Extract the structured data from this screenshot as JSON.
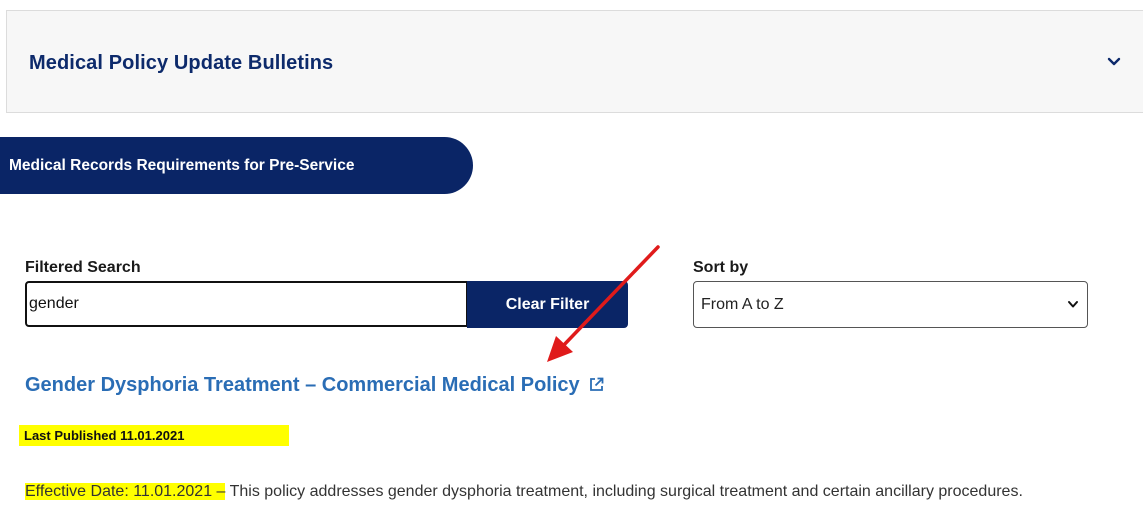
{
  "accordion": {
    "title": "Medical Policy Update Bulletins",
    "icon": "chevron-down-icon"
  },
  "pill_button": {
    "label": "Medical Records Requirements for Pre-Service"
  },
  "filter": {
    "label": "Filtered Search",
    "value": "gender",
    "clear_label": "Clear Filter"
  },
  "sort": {
    "label": "Sort by",
    "selected": "From A to Z"
  },
  "result": {
    "title": "Gender Dysphoria Treatment – Commercial Medical Policy",
    "external_icon": "external-link-icon",
    "last_published": "Last Published 11.01.2021",
    "effective_date": "Effective Date: 11.01.2021 –",
    "description": " This policy addresses gender dysphoria treatment, including surgical treatment and certain ancillary procedures."
  },
  "colors": {
    "brand_navy": "#0a2566",
    "title_navy": "#0d2a6b",
    "link_blue": "#2a6db5",
    "highlight": "#ffff00",
    "annotation_arrow": "#e01b1b"
  }
}
